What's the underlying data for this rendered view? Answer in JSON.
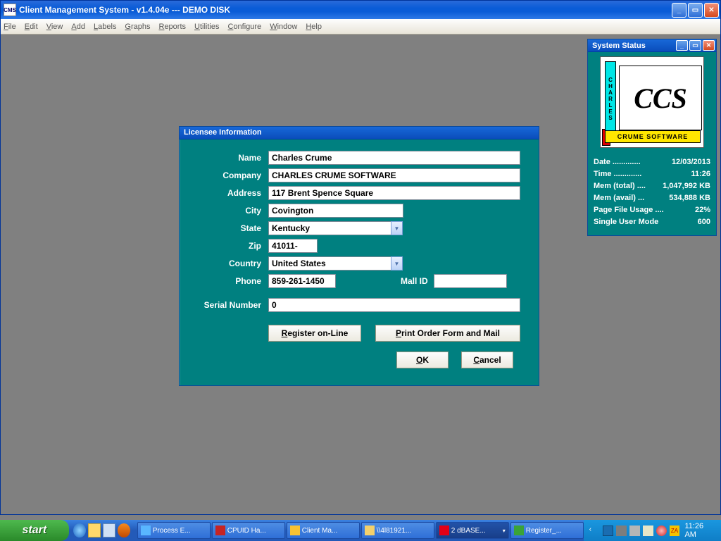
{
  "window": {
    "title": "Client Management System  -  v1.4.04e  ---  DEMO DISK",
    "menu": [
      "File",
      "Edit",
      "View",
      "Add",
      "Labels",
      "Graphs",
      "Reports",
      "Utilities",
      "Configure",
      "Window",
      "Help"
    ]
  },
  "dialog": {
    "title": "Licensee Information",
    "labels": {
      "name": "Name",
      "company": "Company",
      "address": "Address",
      "city": "City",
      "state": "State",
      "zip": "Zip",
      "country": "Country",
      "phone": "Phone",
      "mall_id": "Mall ID",
      "serial": "Serial Number"
    },
    "values": {
      "name": "Charles Crume",
      "company": "CHARLES CRUME SOFTWARE",
      "address": "117 Brent Spence Square",
      "city": "Covington",
      "state": "Kentucky",
      "zip": "41011-",
      "country": "United States",
      "phone": "859-261-1450",
      "mall_id": "",
      "serial": "0"
    },
    "buttons": {
      "register": "Register on-Line",
      "print": "Print Order Form and Mail",
      "ok": "OK",
      "cancel": "Cancel"
    }
  },
  "status": {
    "title": "System Status",
    "logo_vertical": "CHARLES",
    "logo_main": "CCS",
    "logo_sub": "CRUME SOFTWARE",
    "rows": {
      "date_l": "Date .............",
      "date_v": "12/03/2013",
      "time_l": "Time .............",
      "time_v": "11:26",
      "memt_l": "Mem (total) ....",
      "memt_v": "1,047,992 KB",
      "mema_l": "Mem (avail) ...",
      "mema_v": "534,888 KB",
      "pf_l": "Page File Usage ....",
      "pf_v": "22%",
      "su_l": "Single User Mode",
      "su_v": "600"
    }
  },
  "taskbar": {
    "start": "start",
    "tasks": [
      {
        "label": "Process E..."
      },
      {
        "label": "CPUID Ha..."
      },
      {
        "label": "Client Ma..."
      },
      {
        "label": "\\\\4l81921..."
      },
      {
        "label": "2 dBASE... "
      },
      {
        "label": "Register_..."
      }
    ],
    "clock": "11:26 AM"
  }
}
